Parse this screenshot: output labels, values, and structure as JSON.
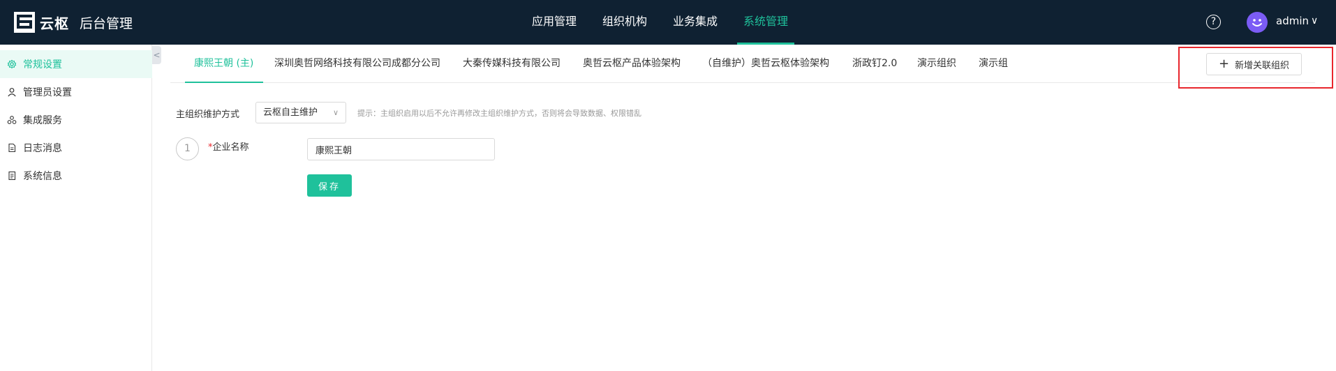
{
  "header": {
    "logo_text": "云枢",
    "app_title": "后台管理",
    "nav": [
      {
        "label": "应用管理",
        "active": false
      },
      {
        "label": "组织机构",
        "active": false
      },
      {
        "label": "业务集成",
        "active": false
      },
      {
        "label": "系统管理",
        "active": true
      }
    ],
    "help_glyph": "?",
    "username": "admin",
    "user_caret_glyph": "∨"
  },
  "sidebar": {
    "collapse_glyph": "<",
    "items": [
      {
        "label": "常规设置",
        "icon": "gear-icon",
        "active": true
      },
      {
        "label": "管理员设置",
        "icon": "user-icon",
        "active": false
      },
      {
        "label": "集成服务",
        "icon": "integration-icon",
        "active": false
      },
      {
        "label": "日志消息",
        "icon": "document-icon",
        "active": false
      },
      {
        "label": "系统信息",
        "icon": "info-doc-icon",
        "active": false
      }
    ]
  },
  "org_tabs": [
    {
      "label": "康熙王朝 (主)",
      "active": true
    },
    {
      "label": "深圳奥哲网络科技有限公司成都分公司",
      "active": false
    },
    {
      "label": "大秦传媒科技有限公司",
      "active": false
    },
    {
      "label": "奥哲云枢产品体验架构",
      "active": false
    },
    {
      "label": "（自维护）奥哲云枢体验架构",
      "active": false
    },
    {
      "label": "浙政钉2.0",
      "active": false
    },
    {
      "label": "演示组织",
      "active": false
    },
    {
      "label": "演示组",
      "active": false
    }
  ],
  "add_org_button": {
    "label": "新增关联组织",
    "plus_glyph": "+"
  },
  "form": {
    "maintain_mode_label": "主组织维护方式",
    "maintain_mode_value": "云枢自主维护",
    "select_caret_glyph": "∨",
    "hint": "提示：主组织启用以后不允许再修改主组织维护方式，否则将会导致数据、权限错乱",
    "step_number": "1",
    "required_mark": "*",
    "company_name_label": "企业名称",
    "company_name_value": "康熙王朝",
    "save_label": "保存"
  },
  "colors": {
    "topbar": "#0f2132",
    "accent": "#1fc19b",
    "highlight_box": "#e8262c",
    "avatar": "#7b5cf5"
  }
}
